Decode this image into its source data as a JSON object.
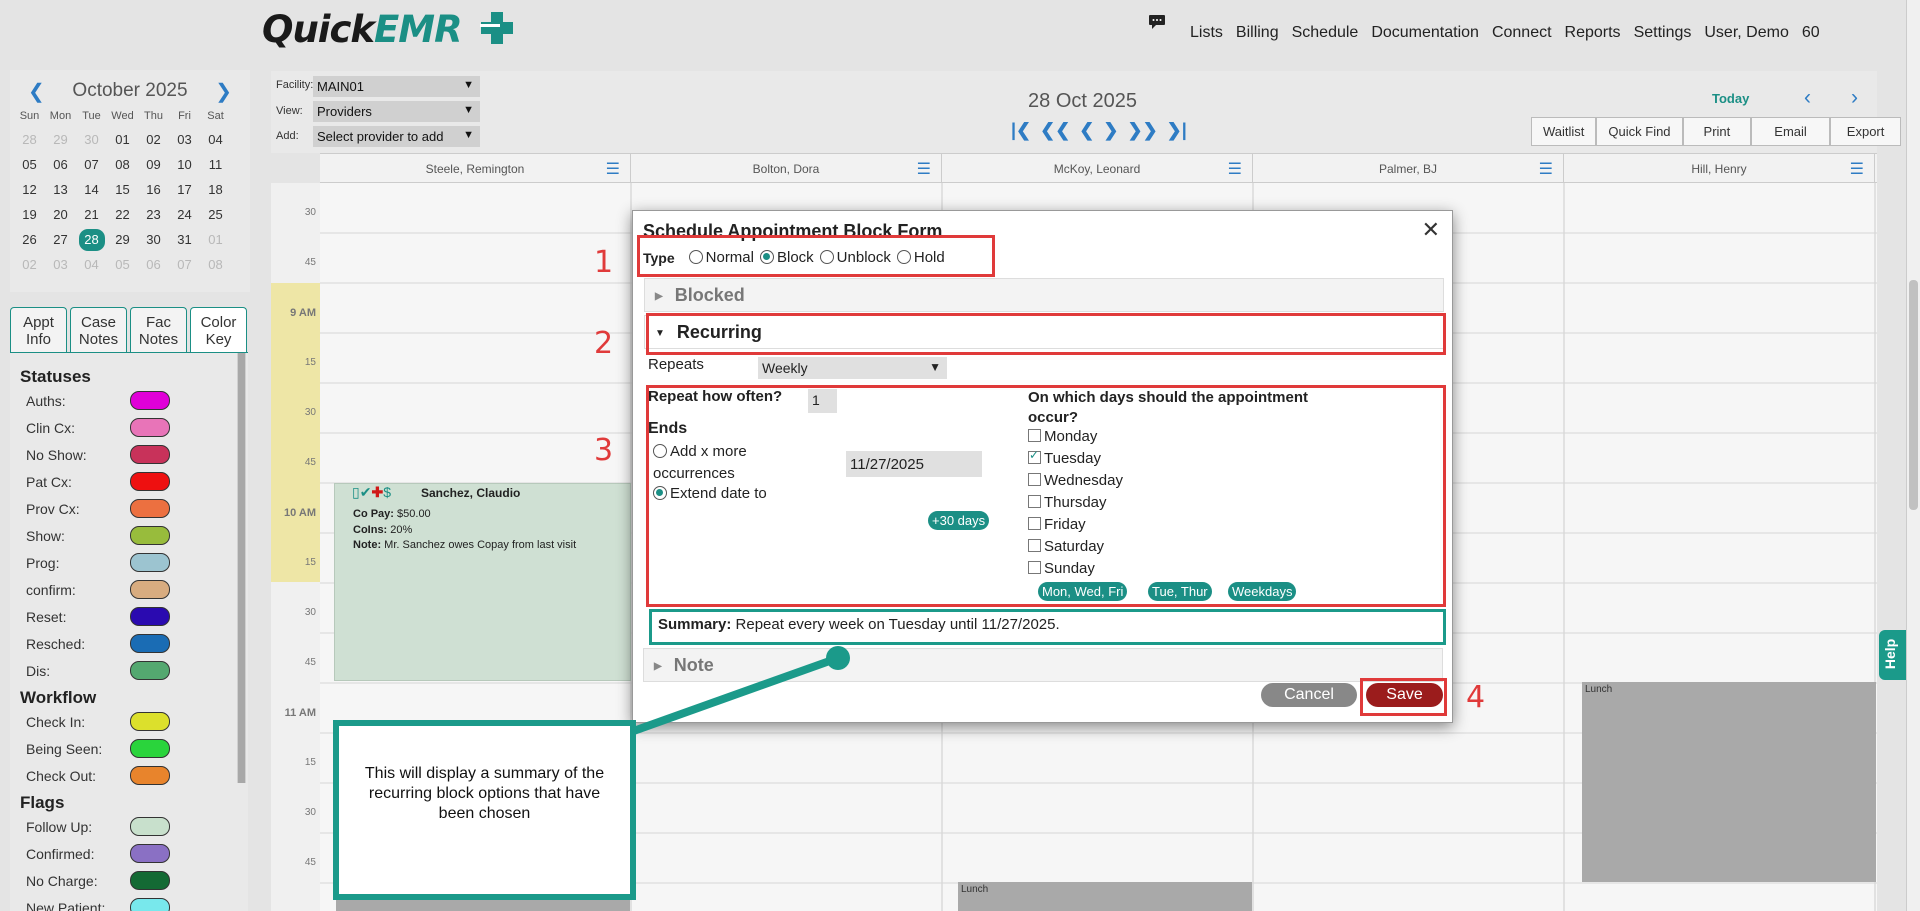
{
  "app": {
    "logo_quick": "Quick",
    "logo_emr": "EMR",
    "nav": [
      "Lists",
      "Billing",
      "Schedule",
      "Documentation",
      "Connect",
      "Reports",
      "Settings",
      "User, Demo",
      "60"
    ]
  },
  "mini_calendar": {
    "month_label": "October 2025",
    "dow": [
      "Sun",
      "Mon",
      "Tue",
      "Wed",
      "Thu",
      "Fri",
      "Sat"
    ],
    "days": [
      "28",
      "29",
      "30",
      "01",
      "02",
      "03",
      "04",
      "05",
      "06",
      "07",
      "08",
      "09",
      "10",
      "11",
      "12",
      "13",
      "14",
      "15",
      "16",
      "17",
      "18",
      "19",
      "20",
      "21",
      "22",
      "23",
      "24",
      "25",
      "26",
      "27",
      "28",
      "29",
      "30",
      "31",
      "01",
      "02",
      "03",
      "04",
      "05",
      "06",
      "07",
      "08"
    ],
    "muted_indices": [
      0,
      1,
      2,
      34,
      35,
      36,
      37,
      38,
      39,
      40,
      41
    ],
    "selected_index": 30
  },
  "left_tabs": [
    {
      "label": "Appt Info"
    },
    {
      "label": "Case Notes"
    },
    {
      "label": "Fac Notes"
    },
    {
      "label": "Color Key"
    }
  ],
  "color_key": {
    "sections": [
      {
        "title": "Statuses",
        "items": [
          {
            "label": "Auths:",
            "color": "#e000d8"
          },
          {
            "label": "Clin Cx:",
            "color": "#e874b8"
          },
          {
            "label": "No Show:",
            "color": "#c8325a"
          },
          {
            "label": "Pat Cx:",
            "color": "#ee1010"
          },
          {
            "label": "Prov Cx:",
            "color": "#ec7040"
          },
          {
            "label": "Show:",
            "color": "#98bc3c"
          },
          {
            "label": "Prog:",
            "color": "#9cc4d0"
          },
          {
            "label": "confirm:",
            "color": "#d8ac80"
          },
          {
            "label": "Reset:",
            "color": "#2a0ab0"
          },
          {
            "label": "Resched:",
            "color": "#1a6cb4"
          },
          {
            "label": "Dis:",
            "color": "#54a870"
          }
        ]
      },
      {
        "title": "Workflow",
        "items": [
          {
            "label": "Check In:",
            "color": "#dce02c"
          },
          {
            "label": "Being Seen:",
            "color": "#2ad43c"
          },
          {
            "label": "Check Out:",
            "color": "#e8842c"
          }
        ]
      },
      {
        "title": "Flags",
        "items": [
          {
            "label": "Follow Up:",
            "color": "#c8e0cc"
          },
          {
            "label": "Confirmed:",
            "color": "#8a70c4"
          },
          {
            "label": "No Charge:",
            "color": "#146a34"
          },
          {
            "label": "New Patient:",
            "color": "#78e8ec"
          }
        ]
      }
    ]
  },
  "controls": {
    "facility_label": "Facility:",
    "facility_value": "MAIN01",
    "view_label": "View:",
    "view_value": "Providers",
    "add_label": "Add:",
    "add_value": "Select provider to add"
  },
  "schedule": {
    "date": "28 Oct 2025",
    "today_label": "Today",
    "toolbar": [
      "Waitlist",
      "Quick Find",
      "Print",
      "Email",
      "Export"
    ],
    "providers": [
      "Steele, Remington",
      "Bolton, Dora",
      "McKoy, Leonard",
      "Palmer, BJ",
      "Hill, Henry"
    ],
    "time_labels": [
      {
        "text": "30",
        "hour": false
      },
      {
        "text": "45",
        "hour": false
      },
      {
        "text": "9 AM",
        "hour": true
      },
      {
        "text": "15",
        "hour": false
      },
      {
        "text": "30",
        "hour": false
      },
      {
        "text": "45",
        "hour": false
      },
      {
        "text": "10 AM",
        "hour": true
      },
      {
        "text": "15",
        "hour": false
      },
      {
        "text": "30",
        "hour": false
      },
      {
        "text": "45",
        "hour": false
      },
      {
        "text": "11 AM",
        "hour": true
      },
      {
        "text": "15",
        "hour": false
      },
      {
        "text": "30",
        "hour": false
      },
      {
        "text": "45",
        "hour": false
      }
    ],
    "appointment": {
      "patient": "Sanchez, Claudio",
      "copay_label": "Co Pay:",
      "copay": "$50.00",
      "coins_label": "CoIns:",
      "coins": "20%",
      "note_label": "Note:",
      "note": "Mr. Sanchez owes Copay from last visit"
    },
    "lunch_label": "Lunch"
  },
  "modal": {
    "title": "Schedule Appointment Block Form",
    "type_label": "Type",
    "types": [
      "Normal",
      "Block",
      "Unblock",
      "Hold"
    ],
    "selected_type": "Block",
    "blocked_label": "Blocked",
    "recurring_label": "Recurring",
    "repeats_label": "Repeats",
    "repeats_value": "Weekly",
    "repeat_how_often_label": "Repeat how often?",
    "repeat_how_often_value": "1",
    "ends_label": "Ends",
    "end_option_1": "Add x more occurrences",
    "end_option_2": "Extend date to",
    "end_date": "11/27/2025",
    "plus30_label": "+30 days",
    "days_question": "On which days should the appointment occur?",
    "days": [
      {
        "label": "Monday",
        "checked": false
      },
      {
        "label": "Tuesday",
        "checked": true
      },
      {
        "label": "Wednesday",
        "checked": false
      },
      {
        "label": "Thursday",
        "checked": false
      },
      {
        "label": "Friday",
        "checked": false
      },
      {
        "label": "Saturday",
        "checked": false
      },
      {
        "label": "Sunday",
        "checked": false
      }
    ],
    "presets": [
      "Mon, Wed, Fri",
      "Tue, Thur",
      "Weekdays"
    ],
    "summary_label": "Summary:",
    "summary_text": "Repeat every week on Tuesday until 11/27/2025.",
    "note_label": "Note",
    "cancel_label": "Cancel",
    "save_label": "Save"
  },
  "annotations": {
    "numbers": [
      "1",
      "2",
      "3",
      "4"
    ],
    "callout": "This will display a summary of the recurring block options that have been chosen"
  },
  "help_label": "Help"
}
